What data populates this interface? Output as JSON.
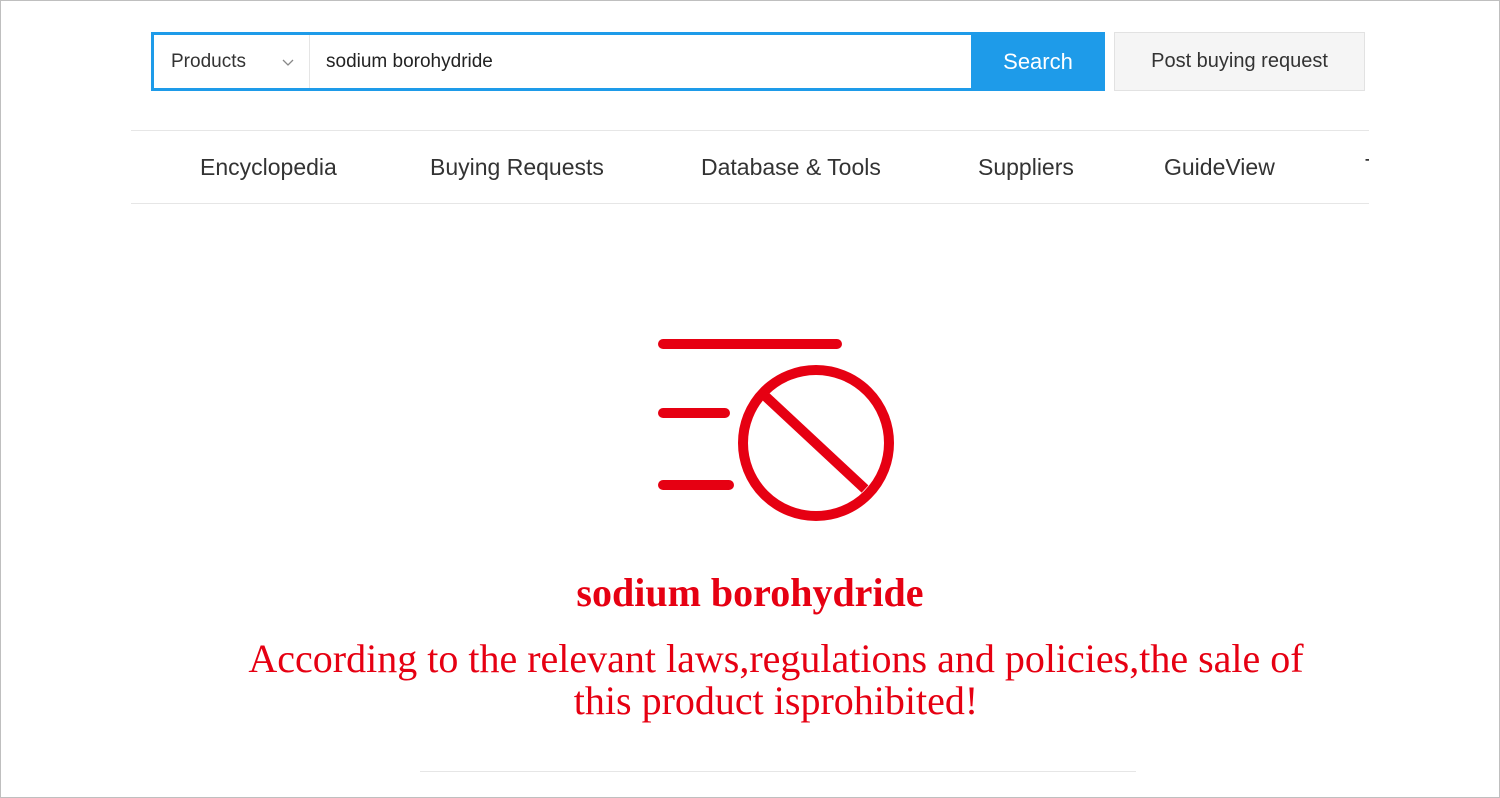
{
  "search": {
    "category": "Products",
    "query": "sodium borohydride",
    "button_label": "Search"
  },
  "post_request": {
    "label": "Post buying request"
  },
  "nav": {
    "items": [
      {
        "label": "Encyclopedia"
      },
      {
        "label": "Buying Requests"
      },
      {
        "label": "Database & Tools"
      },
      {
        "label": "Suppliers"
      },
      {
        "label": "GuideView"
      },
      {
        "label": "T"
      }
    ]
  },
  "notice": {
    "product_name": "sodium borohydride",
    "message": "According to the relevant laws,regulations and policies,the sale of this product isprohibited!",
    "icon": "prohibited-list-icon",
    "color": "#e60012"
  },
  "colors": {
    "accent": "#1e9be9"
  }
}
